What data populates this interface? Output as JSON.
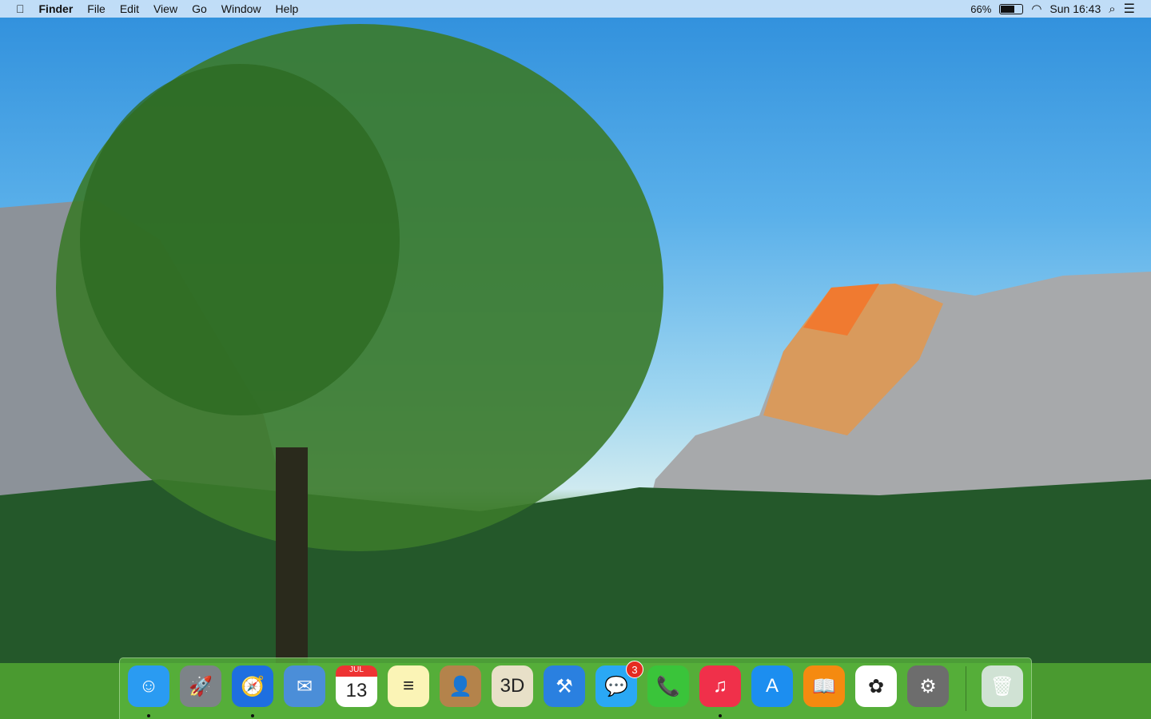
{
  "menubar": {
    "apple": "",
    "app": "Finder",
    "menus": [
      "File",
      "Edit",
      "View",
      "Go",
      "Window",
      "Help"
    ],
    "battery_percent": "66%",
    "battery_level": 66,
    "clock": "Sun 16:43"
  },
  "dock": {
    "apps": [
      {
        "name": "Finder",
        "glyph": "☺",
        "color": "#2a9bf2",
        "running": true
      },
      {
        "name": "Launchpad",
        "glyph": "🚀",
        "color": "#7d8388",
        "running": false
      },
      {
        "name": "Safari",
        "glyph": "🧭",
        "color": "#1e6fe0",
        "running": true
      },
      {
        "name": "Mail",
        "glyph": "✉",
        "color": "#4b8ed8",
        "running": false
      },
      {
        "name": "Calendar",
        "glyph": "13",
        "month": "JUL",
        "color": "#ffffff",
        "running": false
      },
      {
        "name": "Notes",
        "glyph": "≡",
        "color": "#fbf4b6",
        "running": false
      },
      {
        "name": "Contacts",
        "glyph": "👤",
        "color": "#b4834b",
        "running": false
      },
      {
        "name": "Maps",
        "glyph": "3D",
        "color": "#e8e0c8",
        "running": false
      },
      {
        "name": "Xcode",
        "glyph": "⚒",
        "color": "#2a80e0",
        "running": false
      },
      {
        "name": "Messages",
        "glyph": "💬",
        "color": "#2aa8f5",
        "running": false,
        "badge": "3"
      },
      {
        "name": "FaceTime",
        "glyph": "📞",
        "color": "#3ac43a",
        "running": false
      },
      {
        "name": "iTunes",
        "glyph": "♫",
        "color": "#f0304a",
        "running": true
      },
      {
        "name": "App Store",
        "glyph": "A",
        "color": "#1c8ef0",
        "running": false
      },
      {
        "name": "iBooks",
        "glyph": "📖",
        "color": "#f58a10",
        "running": false
      },
      {
        "name": "Photos",
        "glyph": "✿",
        "color": "#ffffff",
        "running": false
      },
      {
        "name": "System Preferences",
        "glyph": "⚙",
        "color": "#6d6d6d",
        "running": false
      }
    ],
    "trash": {
      "name": "Trash",
      "glyph": "🗑"
    }
  }
}
